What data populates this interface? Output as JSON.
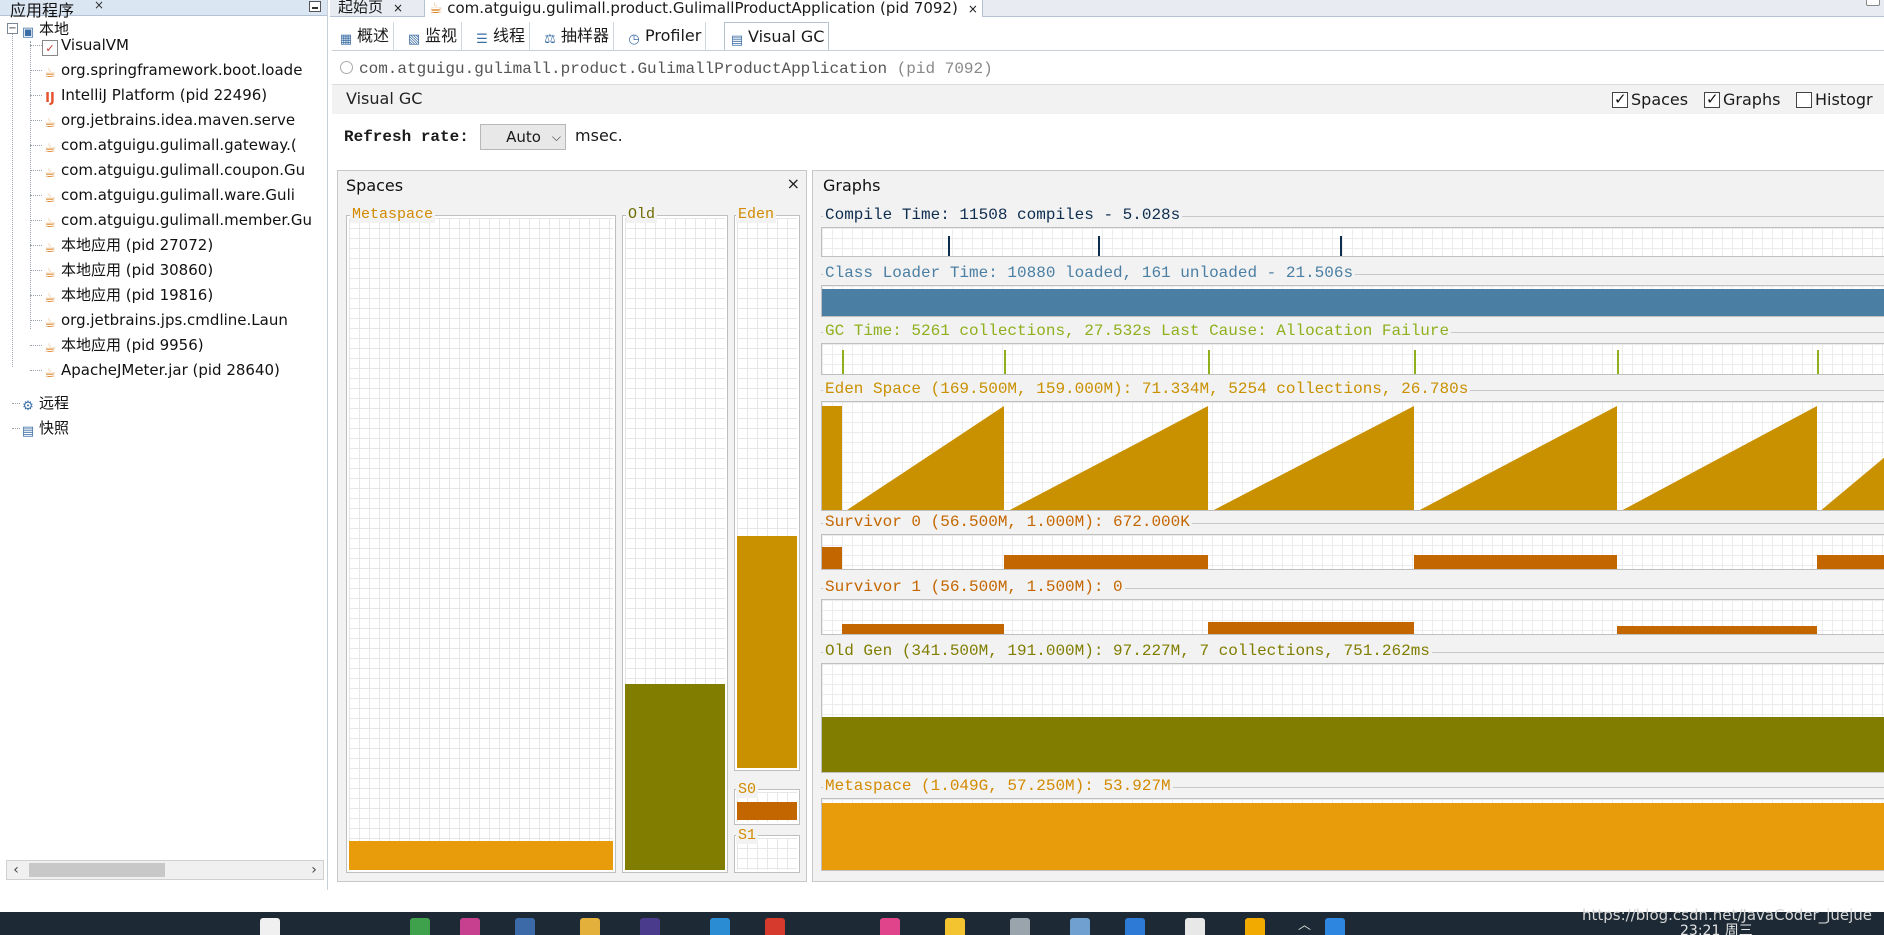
{
  "left_panel": {
    "title": "应用程序",
    "close_glyph": "×",
    "tree": {
      "local": "本地",
      "children": [
        {
          "label": "VisualVM",
          "icon": "visualvm-icon"
        },
        {
          "label": "org.springframework.boot.loade",
          "icon": "java-cup-icon"
        },
        {
          "label": "IntelliJ Platform (pid 22496)",
          "icon": "intellij-icon"
        },
        {
          "label": "org.jetbrains.idea.maven.serve",
          "icon": "java-cup-icon"
        },
        {
          "label": "com.atguigu.gulimall.gateway.(",
          "icon": "java-cup-icon"
        },
        {
          "label": "com.atguigu.gulimall.coupon.Gu",
          "icon": "java-cup-icon"
        },
        {
          "label": "com.atguigu.gulimall.ware.Guli",
          "icon": "java-cup-icon"
        },
        {
          "label": "com.atguigu.gulimall.member.Gu",
          "icon": "java-cup-icon"
        },
        {
          "label": "本地应用 (pid 27072)",
          "icon": "java-cup-icon"
        },
        {
          "label": "本地应用 (pid 30860)",
          "icon": "java-cup-icon"
        },
        {
          "label": "本地应用 (pid 19816)",
          "icon": "java-cup-icon"
        },
        {
          "label": "org.jetbrains.jps.cmdline.Laun",
          "icon": "java-cup-icon"
        },
        {
          "label": "本地应用 (pid 9956)",
          "icon": "java-cup-icon"
        },
        {
          "label": "ApacheJMeter.jar (pid 28640)",
          "icon": "java-cup-icon"
        }
      ],
      "remote": "远程",
      "snapshots": "快照"
    }
  },
  "doc_tabs": [
    {
      "label": "起始页",
      "close": "×"
    },
    {
      "label": "com.atguigu.gulimall.product.GulimallProductApplication (pid 7092)",
      "close": "×"
    }
  ],
  "sub_tabs": [
    {
      "label": "概述",
      "icon": "overview-icon"
    },
    {
      "label": "监视",
      "icon": "monitor-icon"
    },
    {
      "label": "线程",
      "icon": "threads-icon"
    },
    {
      "label": "抽样器",
      "icon": "sampler-icon"
    },
    {
      "label": "Profiler",
      "icon": "profiler-icon"
    },
    {
      "label": "Visual GC",
      "icon": "visualgc-icon"
    }
  ],
  "app_header": {
    "name": "com.atguigu.gulimall.product.GulimallProductApplication",
    "pid": "(pid 7092)"
  },
  "visual_gc": {
    "title": "Visual GC",
    "checkboxes": [
      {
        "label": "Spaces",
        "checked": true
      },
      {
        "label": "Graphs",
        "checked": true
      },
      {
        "label": "Histogr",
        "checked": false
      }
    ],
    "refresh_label": "Refresh rate:",
    "refresh_value": "Auto",
    "refresh_unit": "msec."
  },
  "spaces": {
    "title": "Spaces",
    "close_glyph": "×",
    "metaspace": {
      "label": "Metaspace",
      "fill": 0.045
    },
    "old": {
      "label": "Old",
      "fill": 0.285
    },
    "eden": {
      "label": "Eden",
      "fill": 0.421
    },
    "s0": {
      "label": "S0",
      "fill": 0.6
    },
    "s1": {
      "label": "S1",
      "fill": 0
    }
  },
  "graphs": {
    "title": "Graphs",
    "compile": "Compile Time: 11508 compiles - 5.028s",
    "classloader": "Class Loader Time: 10880 loaded, 161 unloaded - 21.506s",
    "gc": "GC Time: 5261 collections, 27.532s  Last Cause: Allocation Failure",
    "eden": "Eden Space (169.500M, 159.000M): 71.334M, 5254 collections, 26.780s",
    "s0": "Survivor 0 (56.500M, 1.000M): 672.000K",
    "s1": "Survivor 1 (56.500M, 1.500M): 0",
    "oldgen": "Old Gen (341.500M, 191.000M): 97.227M, 7 collections, 751.262ms",
    "metaspace": "Metaspace (1.049G, 57.250M): 53.927M"
  },
  "colors": {
    "compile": "#0d2d4f",
    "classloader": "#4a7fa3",
    "gc": "#8fb01c",
    "eden": "#c99000",
    "survivor": "#c46600",
    "old": "#807d00",
    "metaspace": "#e89c0b"
  },
  "taskbar": {
    "watermark": "https://blog.csdn.net/JavaCoder_juejue",
    "clock": "23:21 周三"
  }
}
